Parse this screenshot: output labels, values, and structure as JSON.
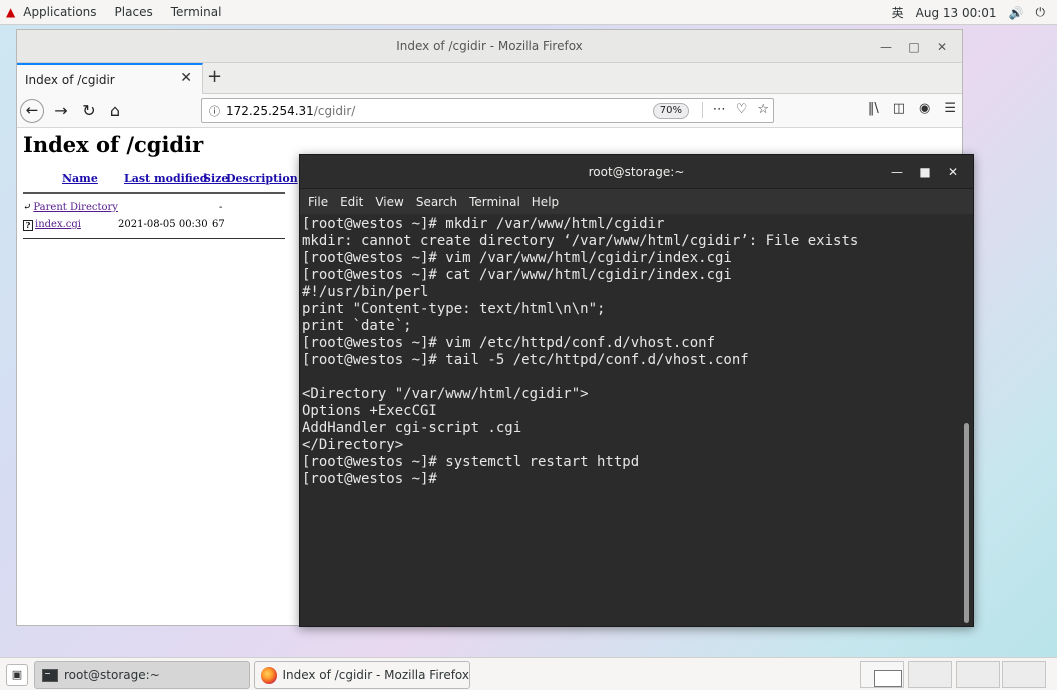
{
  "topbar": {
    "applications": "Applications",
    "places": "Places",
    "terminal": "Terminal",
    "input_method": "英",
    "datetime": "Aug 13 00:01",
    "volume_icon": "volume-icon",
    "power_icon": "power-icon"
  },
  "firefox": {
    "window_title": "Index of /cgidir - Mozilla Firefox",
    "tab_title": "Index of /cgidir",
    "url_host": "172.25.254.31",
    "url_path": "/cgidir/",
    "zoom": "70%",
    "page": {
      "heading": "Index of /cgidir",
      "columns": [
        "Name",
        "Last modified",
        "Size",
        "Description"
      ],
      "rows": [
        {
          "name": "Parent Directory",
          "modified": "",
          "size": "-",
          "description": ""
        },
        {
          "name": "index.cgi",
          "modified": "2021-08-05 00:30",
          "size": "67",
          "description": ""
        }
      ]
    }
  },
  "terminal": {
    "window_title": "root@storage:~",
    "menu": [
      "File",
      "Edit",
      "View",
      "Search",
      "Terminal",
      "Help"
    ],
    "lines": [
      "[root@westos ~]# mkdir /var/www/html/cgidir",
      "mkdir: cannot create directory ‘/var/www/html/cgidir’: File exists",
      "[root@westos ~]# vim /var/www/html/cgidir/index.cgi",
      "[root@westos ~]# cat /var/www/html/cgidir/index.cgi",
      "#!/usr/bin/perl",
      "print \"Content-type: text/html\\n\\n\";",
      "print `date`;",
      "[root@westos ~]# vim /etc/httpd/conf.d/vhost.conf",
      "[root@westos ~]# tail -5 /etc/httpd/conf.d/vhost.conf",
      "",
      "<Directory \"/var/www/html/cgidir\">",
      "Options +ExecCGI",
      "AddHandler cgi-script .cgi",
      "</Directory>",
      "[root@westos ~]# systemctl restart httpd",
      "[root@westos ~]#"
    ]
  },
  "taskbar": {
    "terminal_task": "root@storage:~",
    "firefox_task": "Index of /cgidir - Mozilla Firefox"
  }
}
